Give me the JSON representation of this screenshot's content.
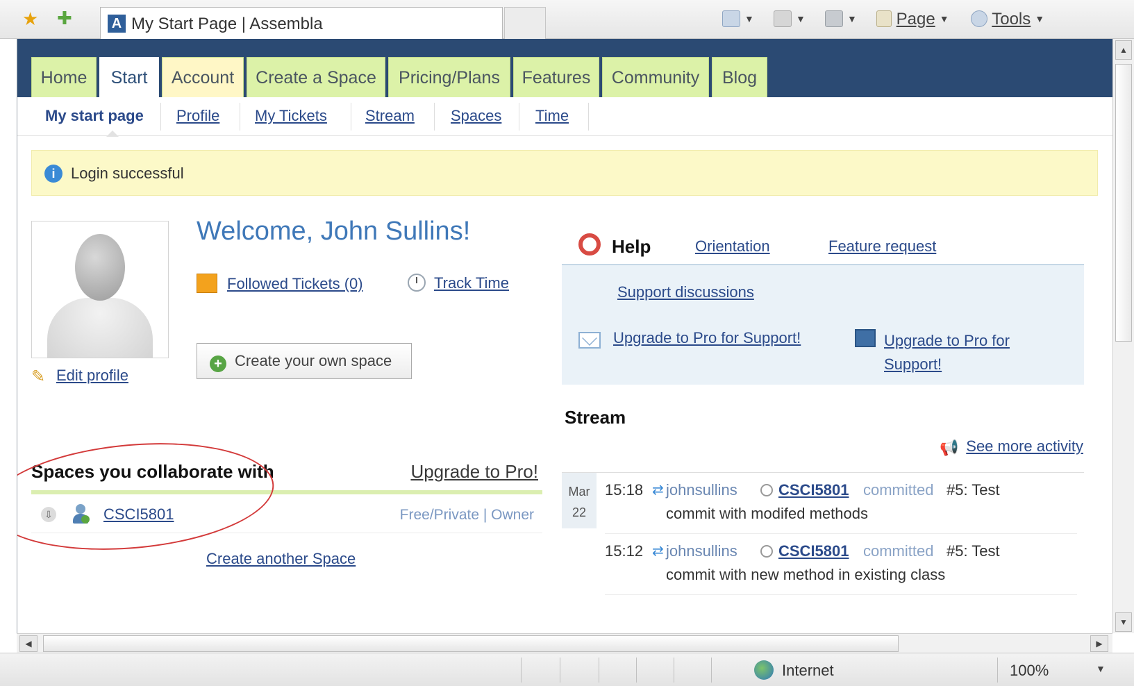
{
  "browser": {
    "tab_title": "My Start Page | Assembla",
    "favicon_letter": "A",
    "commands": {
      "page": "Page",
      "tools": "Tools"
    },
    "status": {
      "zone": "Internet",
      "zoom": "100%"
    }
  },
  "topnav": {
    "tabs": [
      {
        "label": "Home"
      },
      {
        "label": "Start",
        "active": true
      },
      {
        "label": "Account"
      },
      {
        "label": "Create a Space"
      },
      {
        "label": "Pricing/Plans"
      },
      {
        "label": "Features"
      },
      {
        "label": "Community"
      },
      {
        "label": "Blog"
      }
    ]
  },
  "subnav": {
    "items": [
      {
        "label": "My start page",
        "current": true
      },
      {
        "label": "Profile"
      },
      {
        "label": "My Tickets"
      },
      {
        "label": "Stream"
      },
      {
        "label": "Spaces"
      },
      {
        "label": "Time"
      }
    ]
  },
  "flash": {
    "message": "Login successful"
  },
  "profile": {
    "welcome": "Welcome, John Sullins!",
    "edit_profile": "Edit profile",
    "followed_tickets": "Followed Tickets (0)",
    "track_time": "Track Time",
    "create_space_button": "Create your own space"
  },
  "spaces": {
    "title": "Spaces you collaborate with",
    "upgrade": "Upgrade to Pro!",
    "items": [
      {
        "name": "CSCI5801",
        "meta": "Free/Private | Owner"
      }
    ],
    "create_another": "Create another Space"
  },
  "help": {
    "title": "Help",
    "orientation": "Orientation",
    "feature_request": "Feature request",
    "support_discussions": "Support discussions",
    "upgrade_support_1": "Upgrade to Pro for Support!",
    "upgrade_support_2": "Upgrade to Pro for Support!"
  },
  "stream": {
    "title": "Stream",
    "see_more": "See more activity",
    "date": {
      "month": "Mar",
      "day": "22"
    },
    "events": [
      {
        "time": "15:18",
        "user": "johnsullins",
        "space": "CSCI5801",
        "verb": "committed",
        "num": "#5: Test",
        "detail": "commit with modifed methods"
      },
      {
        "time": "15:12",
        "user": "johnsullins",
        "space": "CSCI5801",
        "verb": "committed",
        "num": "#5: Test",
        "detail": "commit with new method in existing class"
      }
    ]
  },
  "colors": {
    "nav_bg": "#2b4a73",
    "tab_green": "#dcf2a8",
    "link": "#2b4a8a",
    "flash_bg": "#fcf9c8",
    "annotation": "#d33a3a"
  },
  "icons": [
    "star-icon",
    "add-favorite-icon",
    "home-icon",
    "feed-icon",
    "print-icon",
    "page-icon",
    "tools-icon",
    "info-icon",
    "pencil-icon",
    "folder-icon",
    "clock-icon",
    "plus-icon",
    "download-icon",
    "user-icon",
    "lifering-icon",
    "mail-icon",
    "screen-icon",
    "megaphone-icon",
    "sync-icon",
    "lock-icon",
    "globe-icon"
  ]
}
